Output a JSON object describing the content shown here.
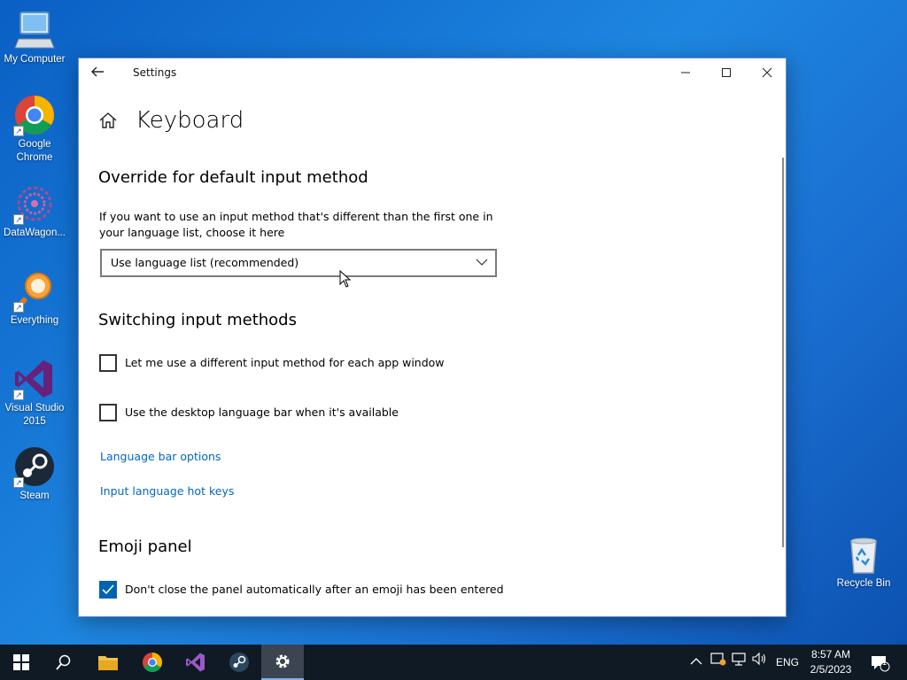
{
  "desktop": {
    "icons": [
      {
        "label": "My Computer"
      },
      {
        "label": "Google Chrome"
      },
      {
        "label": "DataWagon..."
      },
      {
        "label": "Everything"
      },
      {
        "label": "Visual Studio 2015"
      },
      {
        "label": "Steam"
      }
    ],
    "recycle_bin": {
      "label": "Recycle Bin"
    }
  },
  "window": {
    "title": "Settings",
    "page_title": "Keyboard",
    "sections": {
      "override": {
        "title": "Override for default input method",
        "description": "If you want to use an input method that's different than the first one in your language list, choose it here",
        "dropdown_value": "Use language list (recommended)"
      },
      "switching": {
        "title": "Switching input methods",
        "checkbox_per_app": {
          "label": "Let me use a different input method for each app window",
          "checked": false
        },
        "checkbox_language_bar": {
          "label": "Use the desktop language bar when it's available",
          "checked": false
        },
        "link_language_bar_options": "Language bar options",
        "link_hot_keys": "Input language hot keys"
      },
      "emoji": {
        "title": "Emoji panel",
        "checkbox_dont_close": {
          "label": "Don't close the panel automatically after an emoji has been entered",
          "checked": true
        }
      }
    }
  },
  "taskbar": {
    "apps": [
      "start-icon",
      "search-icon",
      "file-explorer-icon",
      "chrome-icon",
      "visual-studio-icon",
      "steam-icon",
      "settings-icon"
    ],
    "active_app": "settings-icon",
    "tray": {
      "language": "ENG",
      "time": "8:57 AM",
      "date": "2/5/2023",
      "notification_count": "1"
    }
  },
  "colors": {
    "accent": "#0063b1",
    "link": "#0067c0",
    "taskbar": "#101a24"
  }
}
